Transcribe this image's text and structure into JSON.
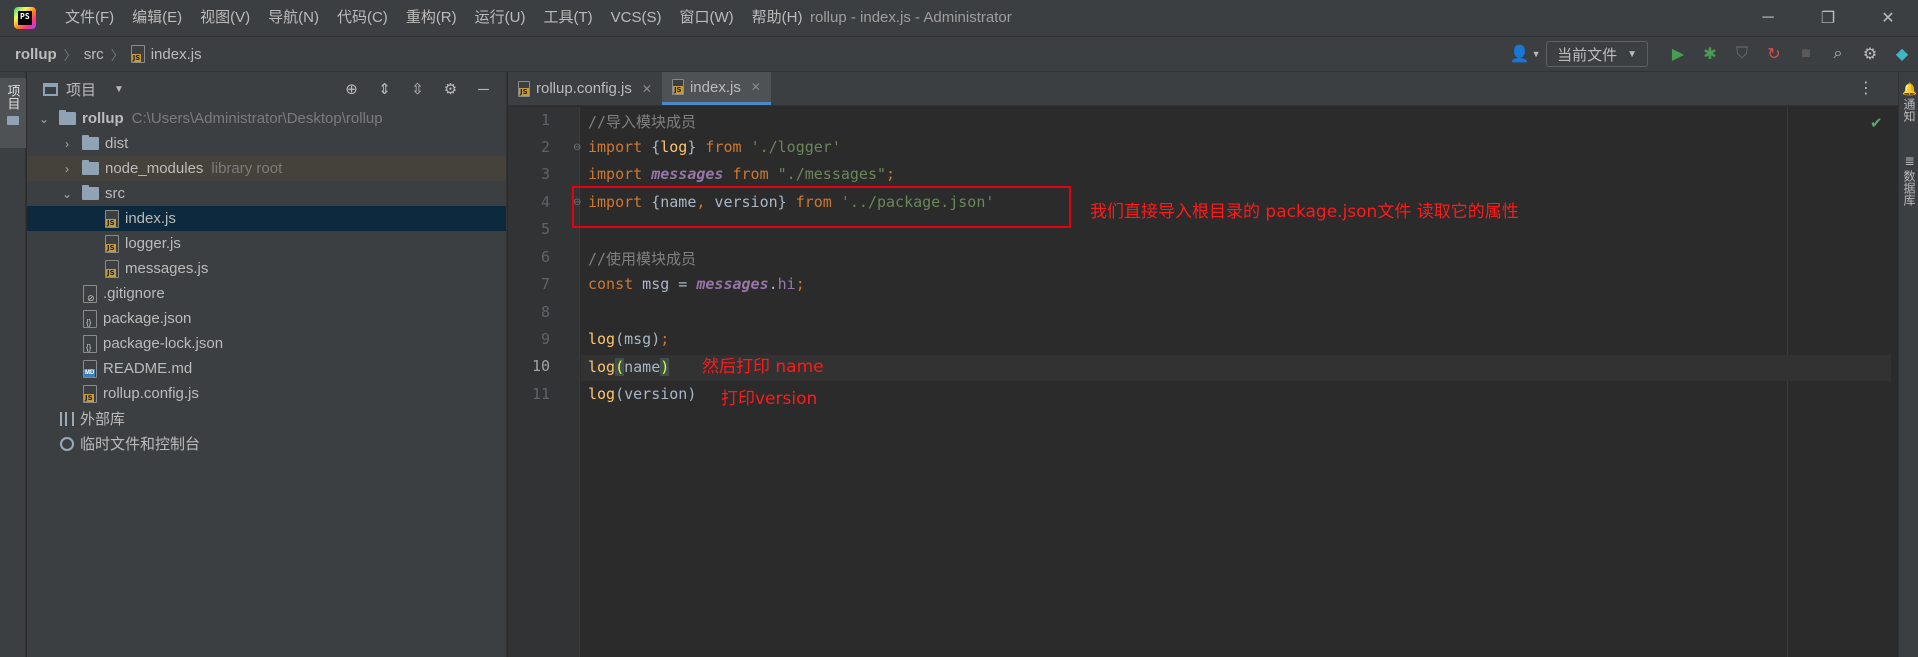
{
  "app": {
    "logo_text": "PS",
    "window_title": "rollup - index.js - Administrator"
  },
  "menu": [
    "文件(F)",
    "编辑(E)",
    "视图(V)",
    "导航(N)",
    "代码(C)",
    "重构(R)",
    "运行(U)",
    "工具(T)",
    "VCS(S)",
    "窗口(W)",
    "帮助(H)"
  ],
  "breadcrumb": {
    "root": "rollup",
    "folder": "src",
    "file": "index.js"
  },
  "toolbar": {
    "run_config": "当前文件"
  },
  "left_strip": {
    "project_tab": "项目"
  },
  "project": {
    "title": "项目",
    "tree": [
      {
        "label": "rollup",
        "extra": "C:\\Users\\Administrator\\Desktop\\rollup"
      },
      {
        "label": "dist"
      },
      {
        "label": "node_modules",
        "extra": "library root"
      },
      {
        "label": "src"
      },
      {
        "label": "index.js"
      },
      {
        "label": "logger.js"
      },
      {
        "label": "messages.js"
      },
      {
        "label": ".gitignore"
      },
      {
        "label": "package.json"
      },
      {
        "label": "package-lock.json"
      },
      {
        "label": "README.md"
      },
      {
        "label": "rollup.config.js"
      },
      {
        "label": "外部库"
      },
      {
        "label": "临时文件和控制台"
      }
    ]
  },
  "tabs": [
    {
      "label": "rollup.config.js"
    },
    {
      "label": "index.js"
    }
  ],
  "editor": {
    "line_numbers": [
      "1",
      "2",
      "3",
      "4",
      "5",
      "6",
      "7",
      "8",
      "9",
      "10",
      "11"
    ],
    "current_line": 10
  },
  "annotations": {
    "line4": "我们直接导入根目录的 package.json文件 读取它的属性",
    "line10": "然后打印 name",
    "line11": "打印version"
  },
  "right_strip": {
    "notifications": "通知",
    "database": "数据库"
  },
  "colors": {
    "accent": "#4a88c7",
    "annotation": "#e60012",
    "keyword": "#cc7832",
    "string": "#6a8759"
  }
}
